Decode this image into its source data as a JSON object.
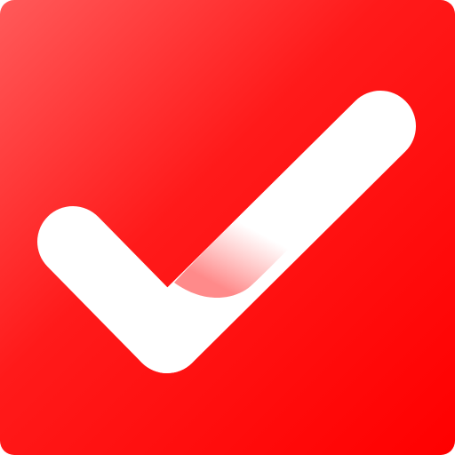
{
  "icon": {
    "name": "checkmark-icon",
    "colors": {
      "background_light": "#ff5a5a",
      "background_mid": "#ff1a1a",
      "background_dark": "#ff0000",
      "check": "#ffffff",
      "check_fold_tint": "#ff8a8a"
    }
  }
}
